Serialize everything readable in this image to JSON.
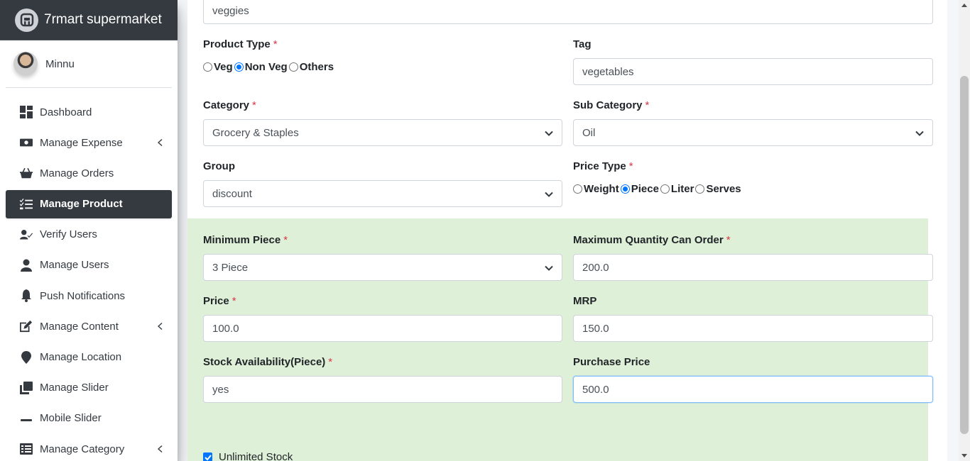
{
  "brand": {
    "name": "7rmart supermarket"
  },
  "user": {
    "name": "Minnu"
  },
  "sidebar": {
    "items": [
      {
        "label": "Dashboard",
        "icon": "dashboard-icon"
      },
      {
        "label": "Manage Expense",
        "icon": "money-icon",
        "has_submenu": true
      },
      {
        "label": "Manage Orders",
        "icon": "basket-icon"
      },
      {
        "label": "Manage Product",
        "icon": "tasks-icon",
        "active": true
      },
      {
        "label": "Verify Users",
        "icon": "user-check-icon"
      },
      {
        "label": "Manage Users",
        "icon": "user-icon"
      },
      {
        "label": "Push Notifications",
        "icon": "bell-icon"
      },
      {
        "label": "Manage Content",
        "icon": "edit-icon",
        "has_submenu": true
      },
      {
        "label": "Manage Location",
        "icon": "map-marker-icon"
      },
      {
        "label": "Manage Slider",
        "icon": "clone-icon"
      },
      {
        "label": "Mobile Slider",
        "icon": "minus-icon"
      },
      {
        "label": "Manage Category",
        "icon": "list-icon",
        "has_submenu": true
      }
    ]
  },
  "form": {
    "top_input_value": "veggies",
    "product_type": {
      "label": "Product Type",
      "options": [
        "Veg",
        "Non Veg",
        "Others"
      ],
      "selected": "Non Veg"
    },
    "tag": {
      "label": "Tag",
      "value": "vegetables"
    },
    "category": {
      "label": "Category",
      "value": "Grocery & Staples"
    },
    "sub_category": {
      "label": "Sub Category",
      "value": "Oil"
    },
    "group": {
      "label": "Group",
      "value": "discount"
    },
    "price_type": {
      "label": "Price Type",
      "options": [
        "Weight",
        "Piece",
        "Liter",
        "Serves"
      ],
      "selected": "Piece"
    },
    "minimum_piece": {
      "label": "Minimum Piece",
      "value": "3 Piece"
    },
    "max_qty": {
      "label": "Maximum Quantity Can Order",
      "value": "200.0"
    },
    "price": {
      "label": "Price",
      "value": "100.0"
    },
    "mrp": {
      "label": "MRP",
      "value": "150.0"
    },
    "stock": {
      "label": "Stock Availability(Piece)",
      "value": "yes"
    },
    "purchase_price": {
      "label": "Purchase Price",
      "value": "500.0"
    },
    "unlimited_stock": {
      "label": "Unlimited Stock",
      "checked": true
    }
  },
  "colors": {
    "sidebar_dark": "#343a40",
    "required": "#dc3545",
    "green_panel": "#dff0d8",
    "radio_blue": "#0075ff"
  }
}
